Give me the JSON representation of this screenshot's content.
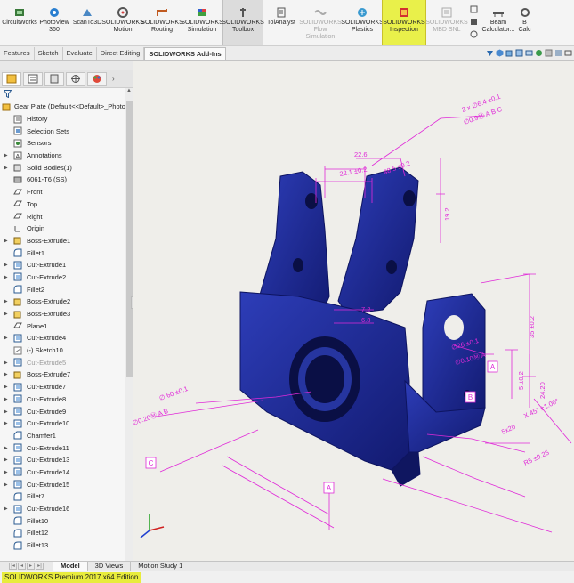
{
  "ribbon": {
    "buttons": [
      {
        "label": "CircuitWorks",
        "icon": "circuitworks-icon"
      },
      {
        "label": "PhotoView\n360",
        "icon": "photoview-icon"
      },
      {
        "label": "ScanTo3D",
        "icon": "scanto3d-icon"
      },
      {
        "label": "SOLIDWORKS\nMotion",
        "icon": "motion-icon"
      },
      {
        "label": "SOLIDWORKS\nRouting",
        "icon": "routing-icon"
      },
      {
        "label": "SOLIDWORKS\nSimulation",
        "icon": "simulation-icon"
      },
      {
        "label": "SOLIDWORKS\nToolbox",
        "icon": "toolbox-icon"
      },
      {
        "label": "TolAnalyst",
        "icon": "tolanalyst-icon"
      },
      {
        "label": "SOLIDWORKS\nFlow\nSimulation",
        "icon": "flow-simulation-icon"
      },
      {
        "label": "SOLIDWORKS\nPlastics",
        "icon": "plastics-icon"
      },
      {
        "label": "SOLIDWORKS\nInspection",
        "icon": "inspection-icon"
      },
      {
        "label": "SOLIDWORKS\nMBD SNL",
        "icon": "mbd-icon"
      },
      {
        "label": "Beam\nCalculator...",
        "icon": "beam-calculator-icon"
      },
      {
        "label": "B\nCalc",
        "icon": "bearing-calculator-icon"
      }
    ]
  },
  "tabs": [
    "Features",
    "Sketch",
    "Evaluate",
    "Direct Editing",
    "SOLIDWORKS Add-Ins"
  ],
  "tree": {
    "root": "Gear Plate  (Default<<Default>_Photo",
    "items": [
      {
        "label": "History",
        "icon": "history-icon",
        "arrow": false
      },
      {
        "label": "Selection Sets",
        "icon": "selection-sets-icon",
        "arrow": false
      },
      {
        "label": "Sensors",
        "icon": "sensors-icon",
        "arrow": false
      },
      {
        "label": "Annotations",
        "icon": "annotations-icon",
        "arrow": true
      },
      {
        "label": "Solid Bodies(1)",
        "icon": "solid-bodies-icon",
        "arrow": true
      },
      {
        "label": "6061-T6 (SS)",
        "icon": "material-icon",
        "arrow": false
      },
      {
        "label": "Front",
        "icon": "plane-icon",
        "arrow": false
      },
      {
        "label": "Top",
        "icon": "plane-icon",
        "arrow": false
      },
      {
        "label": "Right",
        "icon": "plane-icon",
        "arrow": false
      },
      {
        "label": "Origin",
        "icon": "origin-icon",
        "arrow": false
      },
      {
        "label": "Boss-Extrude1",
        "icon": "boss-extrude-icon",
        "arrow": true
      },
      {
        "label": "Fillet1",
        "icon": "fillet-icon",
        "arrow": false
      },
      {
        "label": "Cut-Extrude1",
        "icon": "cut-extrude-icon",
        "arrow": true
      },
      {
        "label": "Cut-Extrude2",
        "icon": "cut-extrude-icon",
        "arrow": true
      },
      {
        "label": "Fillet2",
        "icon": "fillet-icon",
        "arrow": false
      },
      {
        "label": "Boss-Extrude2",
        "icon": "boss-extrude-icon",
        "arrow": true
      },
      {
        "label": "Boss-Extrude3",
        "icon": "boss-extrude-icon",
        "arrow": true
      },
      {
        "label": "Plane1",
        "icon": "plane-icon",
        "arrow": false
      },
      {
        "label": "Cut-Extrude4",
        "icon": "cut-extrude-icon",
        "arrow": true
      },
      {
        "label": "(-) Sketch10",
        "icon": "sketch-icon",
        "arrow": false
      },
      {
        "label": "Cut-Extrude5",
        "icon": "cut-extrude-icon",
        "arrow": true,
        "dim": true
      },
      {
        "label": "Boss-Extrude7",
        "icon": "boss-extrude-icon",
        "arrow": true
      },
      {
        "label": "Cut-Extrude7",
        "icon": "cut-extrude-icon",
        "arrow": true
      },
      {
        "label": "Cut-Extrude8",
        "icon": "cut-extrude-icon",
        "arrow": true
      },
      {
        "label": "Cut-Extrude9",
        "icon": "cut-extrude-icon",
        "arrow": true
      },
      {
        "label": "Cut-Extrude10",
        "icon": "cut-extrude-icon",
        "arrow": true
      },
      {
        "label": "Chamfer1",
        "icon": "chamfer-icon",
        "arrow": false
      },
      {
        "label": "Cut-Extrude11",
        "icon": "cut-extrude-icon",
        "arrow": true
      },
      {
        "label": "Cut-Extrude13",
        "icon": "cut-extrude-icon",
        "arrow": true
      },
      {
        "label": "Cut-Extrude14",
        "icon": "cut-extrude-icon",
        "arrow": true
      },
      {
        "label": "Cut-Extrude15",
        "icon": "cut-extrude-icon",
        "arrow": true
      },
      {
        "label": "Fillet7",
        "icon": "fillet-icon",
        "arrow": false
      },
      {
        "label": "Cut-Extrude16",
        "icon": "cut-extrude-icon",
        "arrow": true
      },
      {
        "label": "Fillet10",
        "icon": "fillet-icon",
        "arrow": false
      },
      {
        "label": "Fillet12",
        "icon": "fillet-icon",
        "arrow": false
      },
      {
        "label": "Fillet13",
        "icon": "fillet-icon",
        "arrow": false
      }
    ]
  },
  "annotations": {
    "d_2x_hole": "2 x ∅6.4 ±0.1",
    "d_fcf_top": "∅0.9Ⓜ A B C",
    "d_22_6": "22.6",
    "d_22_1": "22.1 ±0.2",
    "d_48_5": "48.5 ±0.2",
    "d_19_2": "19.2",
    "d_7_2": "7.2",
    "d_6_8": "6.8",
    "d_35": "35 ±0.2",
    "d_26": "∅26 ±0.1",
    "d_fcf_mid": "∅0.10Ⓜ A",
    "d_5": "5 ±0.2",
    "d_24": "24.20",
    "d_chamfer": "X 45° ±1.00°",
    "d_5x20": "5x20",
    "d_r5": "R5 ±0.25",
    "d_60": "∅ 60 ±0.1",
    "d_fcf_left": "∅0.20Ⓜ A B",
    "d_ref_c": "C",
    "d_ref_a_bottom": "A",
    "d_ref_a_right": "A",
    "d_ref_b": "B"
  },
  "bottom_tabs": [
    "Model",
    "3D Views",
    "Motion Study 1"
  ],
  "status_text": "SOLIDWORKS Premium 2017 x64 Edition",
  "colors": {
    "part": "#1f2a9a",
    "annotation": "#e02ad8",
    "highlight": "#e9f04a"
  }
}
